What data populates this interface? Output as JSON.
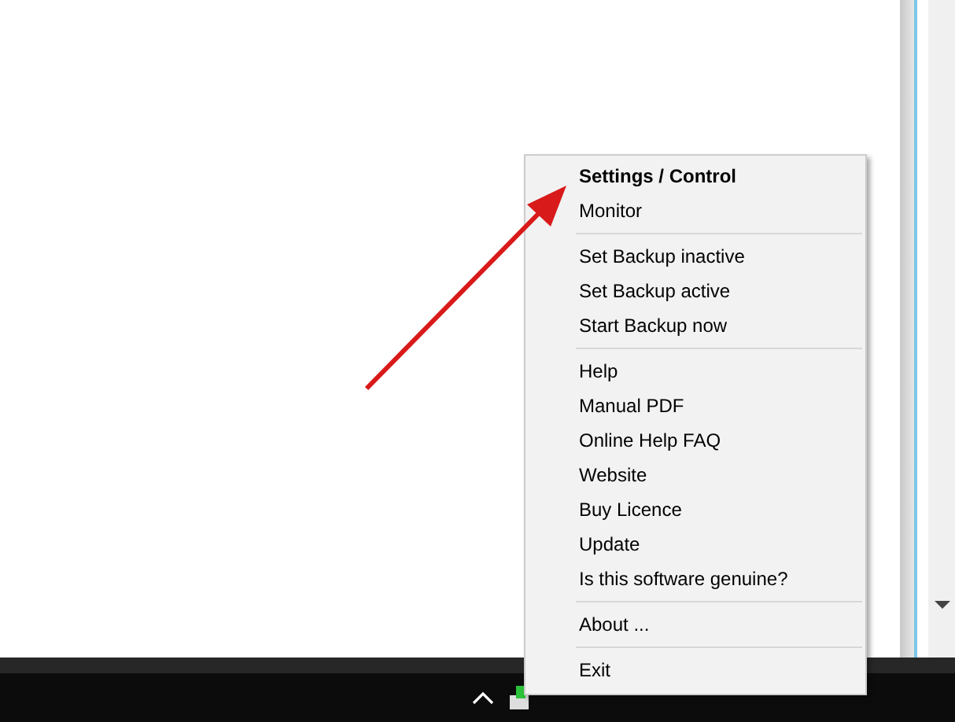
{
  "context_menu": {
    "groups": [
      [
        {
          "label": "Settings / Control",
          "default": true
        },
        {
          "label": "Monitor",
          "default": false
        }
      ],
      [
        {
          "label": "Set Backup inactive",
          "default": false
        },
        {
          "label": "Set Backup active",
          "default": false
        },
        {
          "label": "Start Backup now",
          "default": false
        }
      ],
      [
        {
          "label": "Help",
          "default": false
        },
        {
          "label": "Manual PDF",
          "default": false
        },
        {
          "label": "Online Help FAQ",
          "default": false
        },
        {
          "label": "Website",
          "default": false
        },
        {
          "label": "Buy Licence",
          "default": false
        },
        {
          "label": "Update",
          "default": false
        },
        {
          "label": "Is this software genuine?",
          "default": false
        }
      ],
      [
        {
          "label": "About ...",
          "default": false
        }
      ],
      [
        {
          "label": "Exit",
          "default": false
        }
      ]
    ]
  }
}
